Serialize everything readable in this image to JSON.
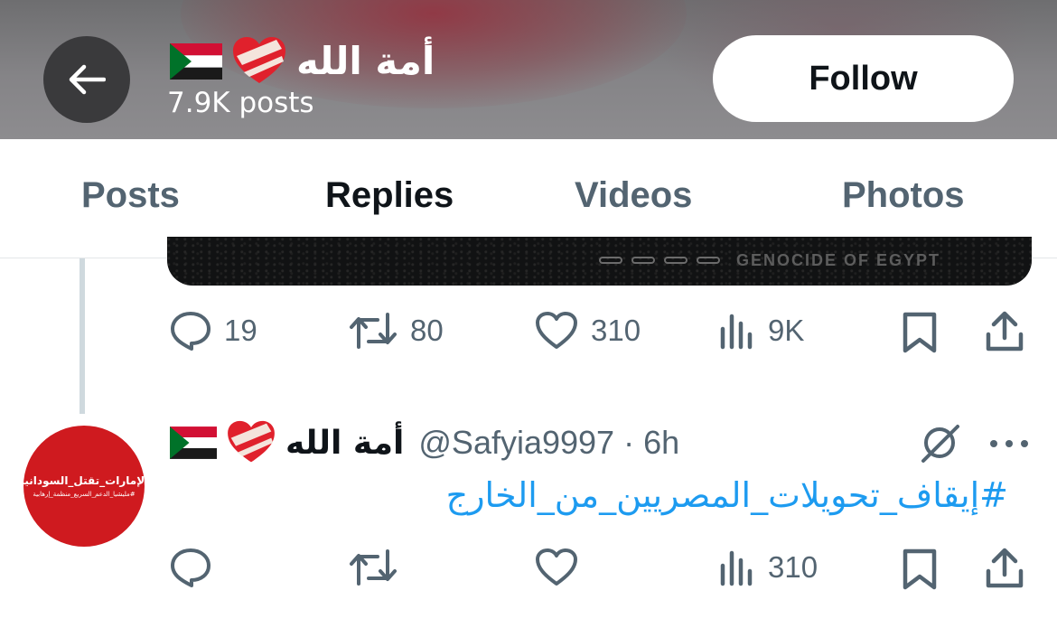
{
  "header": {
    "profile_name": "أمة الله",
    "posts_count": "7.9K posts",
    "follow_label": "Follow",
    "icons": [
      "back-arrow-icon",
      "sudan-flag-icon",
      "bandaged-heart-icon"
    ]
  },
  "tabs": [
    {
      "label": "Posts",
      "active": false
    },
    {
      "label": "Replies",
      "active": true
    },
    {
      "label": "Videos",
      "active": false
    },
    {
      "label": "Photos",
      "active": false
    }
  ],
  "post1": {
    "media_caption": "GENOCIDE OF EGYPT",
    "replies": "19",
    "reposts": "80",
    "likes": "310",
    "views": "9K"
  },
  "post2": {
    "display_name": "أمة الله",
    "handle": "@Safyia9997",
    "separator": "·",
    "time": "6h",
    "text": "#إيقاف_تحويلات_المصريين_من_الخارج",
    "avatar_text_main": "#الإمارات_تقتل_السودانيين",
    "avatar_text_sub": "#مليشيا_الدعم_السريع_منظمة_إرهابية",
    "views": "310"
  },
  "colors": {
    "accent": "#1d9bf0",
    "icon_gray": "#536471",
    "text": "#0f1419",
    "avatar_red": "#cf1a1f"
  }
}
